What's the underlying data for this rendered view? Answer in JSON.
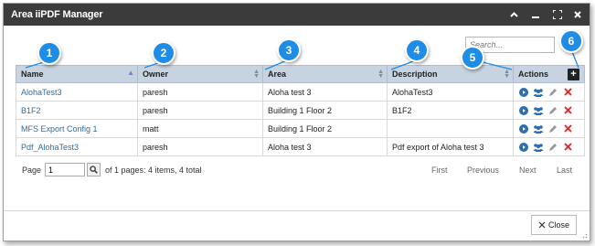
{
  "window": {
    "title": "Area iiPDF Manager"
  },
  "search": {
    "placeholder": "Search..."
  },
  "columns": {
    "name": "Name",
    "owner": "Owner",
    "area": "Area",
    "description": "Description",
    "actions": "Actions"
  },
  "rows": [
    {
      "name": "AlohaTest3",
      "owner": "paresh",
      "area": "Aloha test 3",
      "description": "AlohaTest3"
    },
    {
      "name": "B1F2",
      "owner": "paresh",
      "area": "Building 1 Floor 2",
      "description": "B1F2"
    },
    {
      "name": "MFS Export Config 1",
      "owner": "matt",
      "area": "Building 1 Floor 2",
      "description": ""
    },
    {
      "name": "Pdf_AlohaTest3",
      "owner": "paresh",
      "area": "Aloha test 3",
      "description": "Pdf export of Aloha test 3"
    }
  ],
  "pager": {
    "page_label": "Page",
    "page_value": "1",
    "info": "of 1 pages: 4 items, 4 total",
    "first": "First",
    "previous": "Previous",
    "next": "Next",
    "last": "Last"
  },
  "footer": {
    "close_label": "Close"
  },
  "callouts": [
    "1",
    "2",
    "3",
    "4",
    "5",
    "6"
  ],
  "colors": {
    "titlebar": "#3b3b3b",
    "header_bg": "#c7d3e0",
    "link": "#2e6da4",
    "callout": "#1f8ce6",
    "play": "#2a6db0",
    "users": "#2a6db0",
    "edit": "#9a9a9a",
    "delete": "#d9262b"
  },
  "icons": {
    "sort_asc": "sort-asc-icon",
    "play": "play-icon",
    "users": "users-icon",
    "edit": "pencil-icon",
    "delete": "delete-x-icon",
    "add": "plus-icon"
  }
}
